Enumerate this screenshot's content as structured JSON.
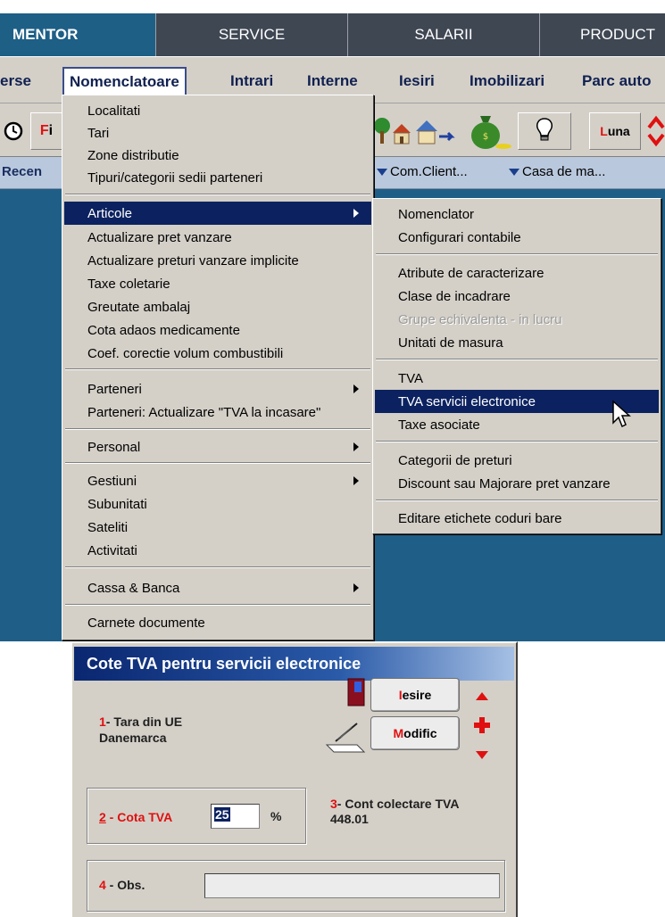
{
  "top_tabs": [
    "MENTOR",
    "SERVICE",
    "SALARII",
    "PRODUCT"
  ],
  "menubar": [
    "erse",
    "Nomenclatoare",
    "Intrari",
    "Interne",
    "Iesiri",
    "Imobilizari",
    "Parc auto"
  ],
  "toolbar": {
    "left_fi_first": "F",
    "left_fi_rest": "i",
    "luna_first": "L",
    "luna_rest": "una"
  },
  "shortcuts": [
    "Recen",
    "Com.Client...",
    "Casa de ma..."
  ],
  "nomenclatoare_menu": [
    "Localitati",
    "Tari",
    "Zone distributie",
    "Tipuri/categorii sedii parteneri",
    "Articole",
    "Actualizare pret vanzare",
    "Actualizare preturi vanzare implicite",
    "Taxe coletarie",
    "Greutate ambalaj",
    "Cota adaos medicamente",
    "Coef. corectie volum combustibili",
    "Parteneri",
    "Parteneri: Actualizare \"TVA la incasare\"",
    "Personal",
    "Gestiuni",
    "Subunitati",
    "Sateliti",
    "Activitati",
    "Cassa & Banca",
    "Carnete documente"
  ],
  "articole_submenu": [
    "Nomenclator",
    "Configurari contabile",
    "Atribute de caracterizare",
    "Clase de incadrare",
    "Grupe echivalenta - in lucru",
    "Unitati de masura",
    "TVA",
    "TVA servicii electronice",
    "Taxe asociate",
    "Categorii de preturi",
    "Discount sau Majorare pret vanzare",
    "Editare etichete coduri bare"
  ],
  "dialog": {
    "title": "Cote TVA pentru servicii electronice",
    "f1_num": "1",
    "f1_label": "- Tara din UE",
    "f1_value": "Danemarca",
    "btn_iesire_first": "I",
    "btn_iesire_rest": "esire",
    "btn_modific_first": "M",
    "btn_modific_rest": "odific",
    "f2_num": "2",
    "f2_label": " - Cota TVA",
    "f2_value": "25",
    "f2_unit": "%",
    "f3_num": "3",
    "f3_label": "- Cont colectare TVA",
    "f3_value": "448.01",
    "f4_num": "4",
    "f4_label": " - Obs.",
    "f4_value": ""
  },
  "colors": {
    "desktop": "#1f5e87",
    "highlight": "#0c2260",
    "accent_red": "#e01010"
  }
}
